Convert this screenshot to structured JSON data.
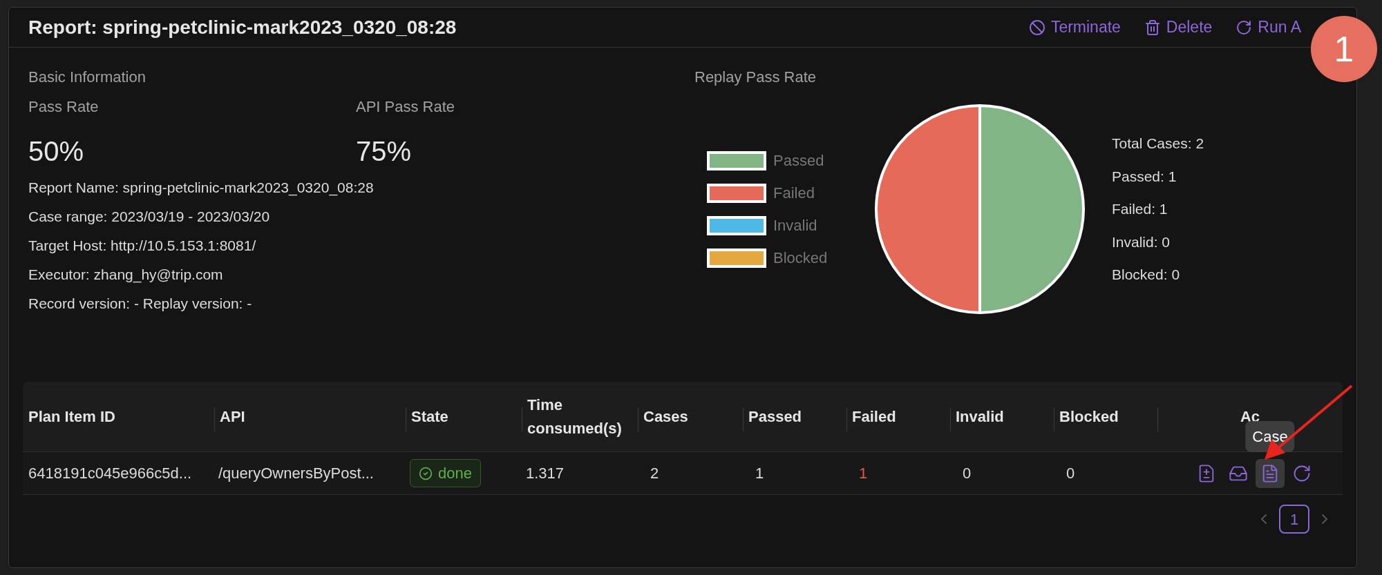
{
  "header": {
    "title": "Report: spring-petclinic-mark2023_0320_08:28",
    "actions": [
      {
        "kind": "terminate",
        "label": "Terminate"
      },
      {
        "kind": "delete",
        "label": "Delete"
      },
      {
        "kind": "rerun",
        "label": "Run A"
      }
    ],
    "badge": "1"
  },
  "basic": {
    "title": "Basic Information",
    "metrics": [
      {
        "label": "Pass Rate",
        "value": "50%"
      },
      {
        "label": "API Pass Rate",
        "value": "75%"
      }
    ],
    "details": [
      "Report Name: spring-petclinic-mark2023_0320_08:28",
      "Case range: 2023/03/19 - 2023/03/20",
      "Target Host: http://10.5.153.1:8081/",
      "Executor: zhang_hy@trip.com",
      "Record version: - Replay version: -"
    ]
  },
  "replay": {
    "title": "Replay Pass Rate",
    "chart_data": {
      "type": "pie",
      "categories": [
        "Passed",
        "Failed",
        "Invalid",
        "Blocked"
      ],
      "values": [
        50,
        50,
        0,
        0
      ],
      "colors": [
        "#82b585",
        "#e66a5a",
        "#4db9e6",
        "#e5a83f"
      ]
    },
    "stats": [
      "Total Cases: 2",
      "Passed: 1",
      "Failed: 1",
      "Invalid: 0",
      "Blocked: 0"
    ]
  },
  "table": {
    "columns": [
      "Plan Item ID",
      "API",
      "State",
      "Time consumed(s)",
      "Cases",
      "Passed",
      "Failed",
      "Invalid",
      "Blocked",
      "Ac"
    ],
    "rows": [
      {
        "plan_item_id": "6418191c045e966c5d...",
        "api": "/queryOwnersByPost...",
        "state": {
          "label": "done",
          "kind": "success"
        },
        "time": "1.317",
        "cases": "2",
        "passed": "1",
        "failed": "1",
        "invalid": "0",
        "blocked": "0",
        "actions": [
          {
            "kind": "diff",
            "hovered": false
          },
          {
            "kind": "tray",
            "hovered": false
          },
          {
            "kind": "case",
            "hovered": true,
            "tooltip": "Case"
          },
          {
            "kind": "rerun",
            "hovered": false
          }
        ]
      }
    ]
  },
  "pagination": {
    "pages": [
      {
        "label": "1",
        "selected": true
      }
    ]
  }
}
